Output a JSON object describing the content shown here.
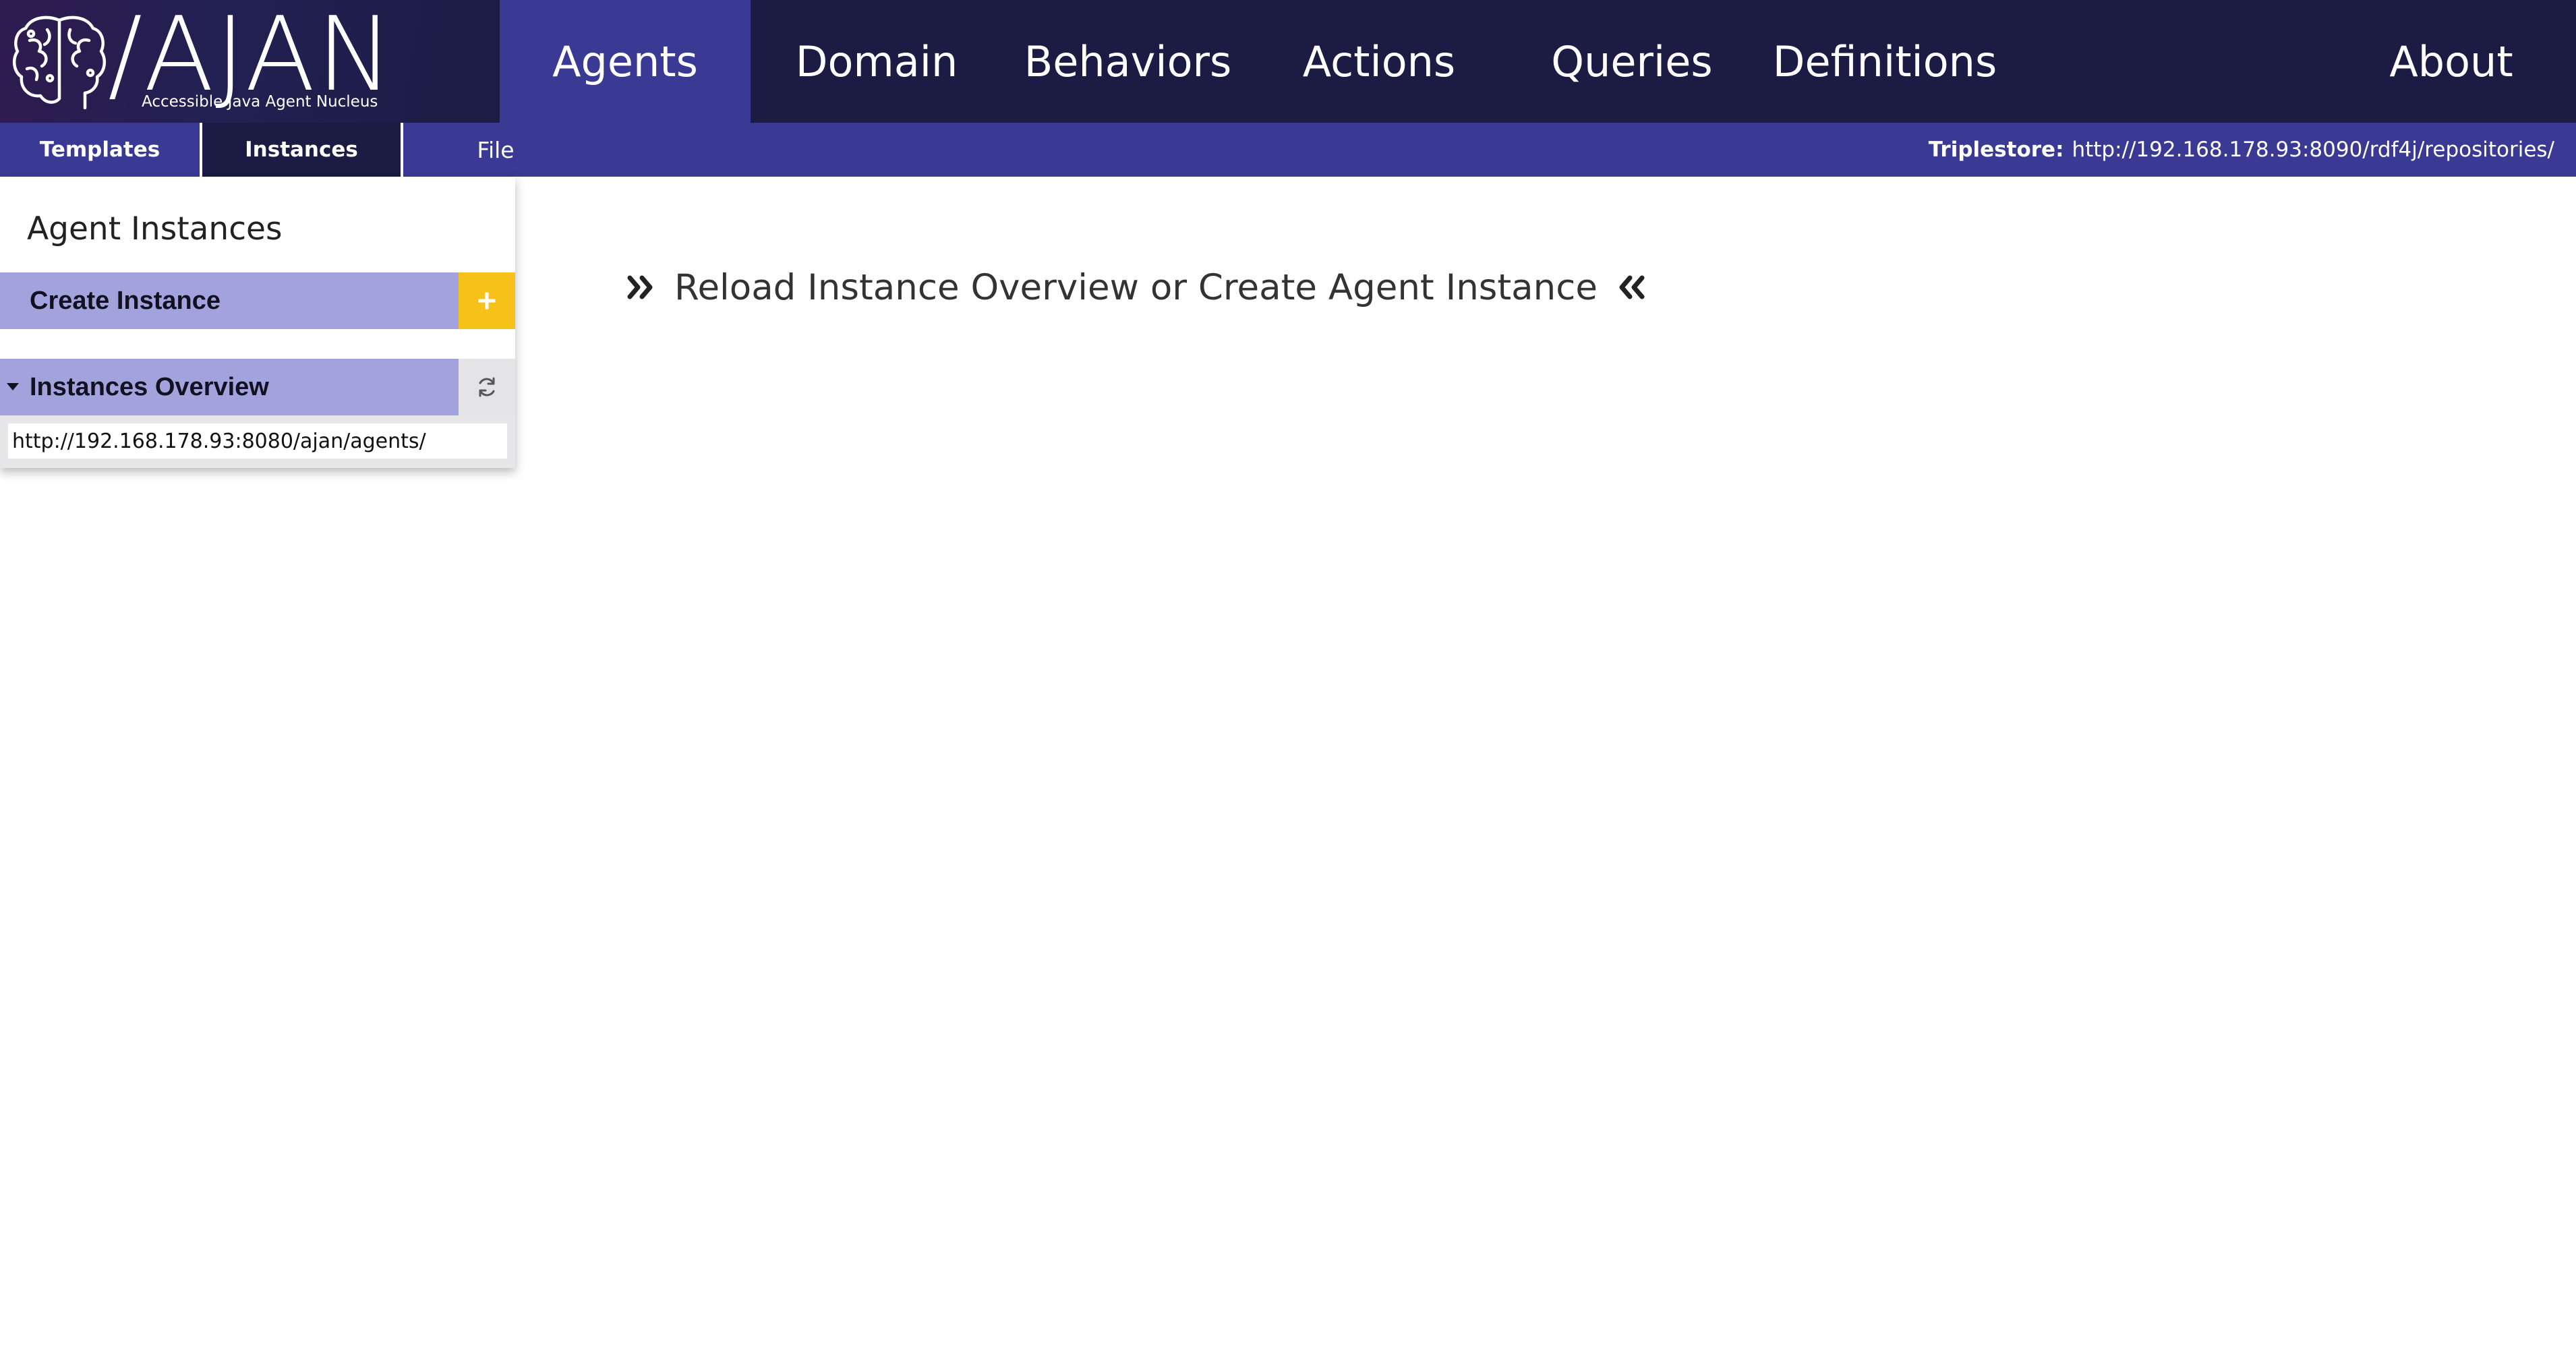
{
  "app": {
    "logo_title": "/AJAN",
    "logo_subtitle": "Accessible Java Agent Nucleus"
  },
  "nav": {
    "items": [
      {
        "label": "Agents",
        "active": true
      },
      {
        "label": "Domain",
        "active": false
      },
      {
        "label": "Behaviors",
        "active": false
      },
      {
        "label": "Actions",
        "active": false
      },
      {
        "label": "Queries",
        "active": false
      },
      {
        "label": "Definitions",
        "active": false
      },
      {
        "label": "About",
        "active": false
      }
    ]
  },
  "subnav": {
    "tabs": [
      {
        "label": "Templates",
        "active": false
      },
      {
        "label": "Instances",
        "active": true
      },
      {
        "label": "File",
        "active": false
      }
    ],
    "triplestore_label": "Triplestore:",
    "triplestore_url": "http://192.168.178.93:8090/rdf4j/repositories/"
  },
  "panel": {
    "title": "Agent Instances",
    "create_label": "Create Instance",
    "overview_label": "Instances Overview",
    "agents_url": "http://192.168.178.93:8080/ajan/agents/"
  },
  "main": {
    "message": "Reload Instance Overview or Create Agent Instance"
  },
  "colors": {
    "nav_bg": "#1b1b43",
    "accent": "#3a3a94",
    "panel_row": "#a2a3dc",
    "add_button": "#f6c21a"
  },
  "icons": {
    "logo": "brain-icon",
    "add": "plus-icon",
    "reload": "refresh-icon",
    "expand": "caret-down-icon",
    "message_left": "double-chevron-right-icon",
    "message_right": "double-chevron-left-icon"
  }
}
